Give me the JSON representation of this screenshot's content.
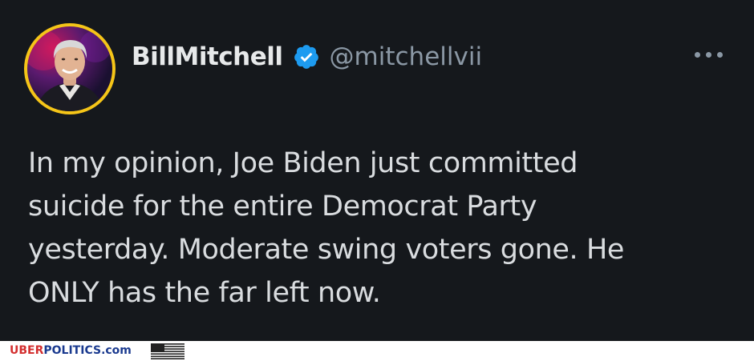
{
  "tweet": {
    "display_name": "BillMitchell",
    "handle": "@mitchellvii",
    "verified": true,
    "text_lines": [
      "In my opinion, Joe Biden just committed",
      "suicide for the entire Democrat Party",
      "yesterday. Moderate swing voters gone. He",
      "ONLY has the far left now."
    ],
    "icons": {
      "verified": "verified-badge-icon",
      "more": "more-horizontal-icon"
    }
  },
  "footer": {
    "watermark_part1": "UBER",
    "watermark_part2": "POLITICS",
    "watermark_part3": ".com"
  },
  "colors": {
    "background": "#15181c",
    "avatar_ring": "#f5c518",
    "verified_blue": "#1d9bf0",
    "name": "#e7e9ea",
    "handle": "#8b98a5"
  }
}
